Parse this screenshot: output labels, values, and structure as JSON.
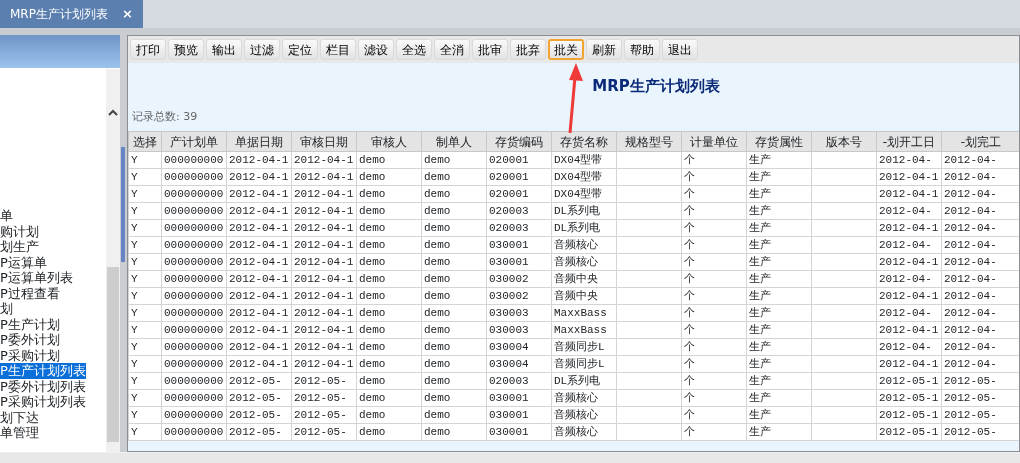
{
  "tabs": [
    {
      "label": "MRP生产计划列表",
      "close": "×",
      "selected": true
    }
  ],
  "sidebar": {
    "items": [
      {
        "label": "单",
        "selected": false
      },
      {
        "label": "购计划",
        "selected": false
      },
      {
        "label": "划生产",
        "selected": false
      },
      {
        "label": "P运算单",
        "selected": false
      },
      {
        "label": "P运算单列表",
        "selected": false
      },
      {
        "label": "P过程查看",
        "selected": false
      },
      {
        "label": "划",
        "selected": false
      },
      {
        "label": "P生产计划",
        "selected": false
      },
      {
        "label": "P委外计划",
        "selected": false
      },
      {
        "label": "P采购计划",
        "selected": false
      },
      {
        "label": "P生产计划列表",
        "selected": true
      },
      {
        "label": "P委外计划列表",
        "selected": false
      },
      {
        "label": "P采购计划列表",
        "selected": false
      },
      {
        "label": "划下达",
        "selected": false
      },
      {
        "label": "单管理",
        "selected": false
      }
    ]
  },
  "toolbar": [
    {
      "label": "打印",
      "highlighted": false
    },
    {
      "label": "预览",
      "highlighted": false
    },
    {
      "label": "输出",
      "highlighted": false
    },
    {
      "label": "过滤",
      "highlighted": false
    },
    {
      "label": "定位",
      "highlighted": false
    },
    {
      "label": "栏目",
      "highlighted": false
    },
    {
      "label": "滤设",
      "highlighted": false
    },
    {
      "label": "全选",
      "highlighted": false
    },
    {
      "label": "全消",
      "highlighted": false
    },
    {
      "label": "批审",
      "highlighted": false
    },
    {
      "label": "批弃",
      "highlighted": false
    },
    {
      "label": "批关",
      "highlighted": true
    },
    {
      "label": "刷新",
      "highlighted": false
    },
    {
      "label": "帮助",
      "highlighted": false
    },
    {
      "label": "退出",
      "highlighted": false
    }
  ],
  "report": {
    "title": "MRP生产计划列表",
    "record_count": "记录总数: 39"
  },
  "table": {
    "columns": [
      "选择",
      "产计划单",
      "单据日期",
      "审核日期",
      "审核人",
      "制单人",
      "存货编码",
      "存货名称",
      "规格型号",
      "计量单位",
      "存货属性",
      "版本号",
      "-划开工日",
      "-划完工"
    ],
    "rows": [
      [
        "Y",
        "000000000",
        "2012-04-1",
        "2012-04-1",
        "demo",
        "demo",
        "020001",
        "DX04型带",
        null,
        "个",
        "生产",
        null,
        "2012-04-",
        "2012-04-"
      ],
      [
        "Y",
        "000000000",
        "2012-04-1",
        "2012-04-1",
        "demo",
        "demo",
        "020001",
        "DX04型带",
        null,
        "个",
        "生产",
        null,
        "2012-04-1",
        "2012-04-"
      ],
      [
        "Y",
        "000000000",
        "2012-04-1",
        "2012-04-1",
        "demo",
        "demo",
        "020001",
        "DX04型带",
        null,
        "个",
        "生产",
        null,
        "2012-04-1",
        "2012-04-"
      ],
      [
        "Y",
        "000000000",
        "2012-04-1",
        "2012-04-1",
        "demo",
        "demo",
        "020003",
        "DL系列电",
        null,
        "个",
        "生产",
        null,
        "2012-04-",
        "2012-04-"
      ],
      [
        "Y",
        "000000000",
        "2012-04-1",
        "2012-04-1",
        "demo",
        "demo",
        "020003",
        "DL系列电",
        null,
        "个",
        "生产",
        null,
        "2012-04-1",
        "2012-04-"
      ],
      [
        "Y",
        "000000000",
        "2012-04-1",
        "2012-04-1",
        "demo",
        "demo",
        "030001",
        "音频核心",
        null,
        "个",
        "生产",
        null,
        "2012-04-",
        "2012-04-"
      ],
      [
        "Y",
        "000000000",
        "2012-04-1",
        "2012-04-1",
        "demo",
        "demo",
        "030001",
        "音频核心",
        null,
        "个",
        "生产",
        null,
        "2012-04-1",
        "2012-04-"
      ],
      [
        "Y",
        "000000000",
        "2012-04-1",
        "2012-04-1",
        "demo",
        "demo",
        "030002",
        "音频中央",
        null,
        "个",
        "生产",
        null,
        "2012-04-",
        "2012-04-"
      ],
      [
        "Y",
        "000000000",
        "2012-04-1",
        "2012-04-1",
        "demo",
        "demo",
        "030002",
        "音频中央",
        null,
        "个",
        "生产",
        null,
        "2012-04-1",
        "2012-04-"
      ],
      [
        "Y",
        "000000000",
        "2012-04-1",
        "2012-04-1",
        "demo",
        "demo",
        "030003",
        "MaxxBass",
        null,
        "个",
        "生产",
        null,
        "2012-04-",
        "2012-04-"
      ],
      [
        "Y",
        "000000000",
        "2012-04-1",
        "2012-04-1",
        "demo",
        "demo",
        "030003",
        "MaxxBass",
        null,
        "个",
        "生产",
        null,
        "2012-04-1",
        "2012-04-"
      ],
      [
        "Y",
        "000000000",
        "2012-04-1",
        "2012-04-1",
        "demo",
        "demo",
        "030004",
        "音频同步L",
        null,
        "个",
        "生产",
        null,
        "2012-04-",
        "2012-04-"
      ],
      [
        "Y",
        "000000000",
        "2012-04-1",
        "2012-04-1",
        "demo",
        "demo",
        "030004",
        "音频同步L",
        null,
        "个",
        "生产",
        null,
        "2012-04-1",
        "2012-04-"
      ],
      [
        "Y",
        "000000000",
        "2012-05-",
        "2012-05-",
        "demo",
        "demo",
        "020003",
        "DL系列电",
        null,
        "个",
        "生产",
        null,
        "2012-05-1",
        "2012-05-"
      ],
      [
        "Y",
        "000000000",
        "2012-05-",
        "2012-05-",
        "demo",
        "demo",
        "030001",
        "音频核心",
        null,
        "个",
        "生产",
        null,
        "2012-05-1",
        "2012-05-"
      ],
      [
        "Y",
        "000000000",
        "2012-05-",
        "2012-05-",
        "demo",
        "demo",
        "030001",
        "音频核心",
        null,
        "个",
        "生产",
        null,
        "2012-05-1",
        "2012-05-"
      ],
      [
        "Y",
        "000000000",
        "2012-05-",
        "2012-05-",
        "demo",
        "demo",
        "030001",
        "音频核心",
        null,
        "个",
        "生产",
        null,
        "2012-05-1",
        "2012-05-"
      ]
    ]
  }
}
